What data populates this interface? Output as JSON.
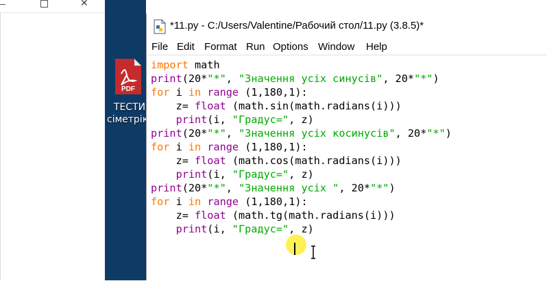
{
  "desktop": {
    "icon": "pdf-file-icon",
    "icon_text": "PDF",
    "label_line1": "ТЕСТИ",
    "label_line2": "сіметрік"
  },
  "window": {
    "title": "*11.py - C:/Users/Valentine/Рабочий стол/11.py (3.8.5)*",
    "menu": [
      "File",
      "Edit",
      "Format",
      "Run",
      "Options",
      "Window",
      "Help"
    ]
  },
  "code_lines": [
    "import math",
    "print(20*\"*\", \"Значення усіх синусів\", 20*\"*\")",
    "for i in range (1,180,1):",
    "    z= float (math.sin(math.radians(i)))",
    "    print(i, \"Градус=\", z)",
    "print(20*\"*\", \"Значення усіх косинусів\", 20*\"*\")",
    "for i in range (1,180,1):",
    "    z= float (math.cos(math.radians(i)))",
    "    print(i, \"Градус=\", z)",
    "print(20*\"*\", \"Значення усіх \", 20*\"*\")",
    "for i in range (1,180,1):",
    "    z= float (math.tg(math.radians(i)))",
    "    print(i, \"Градус=\", z)"
  ],
  "colors": {
    "keyword": "#ff7700",
    "builtin": "#900090",
    "string": "#00aa00",
    "desktop": "#0e3a66"
  }
}
